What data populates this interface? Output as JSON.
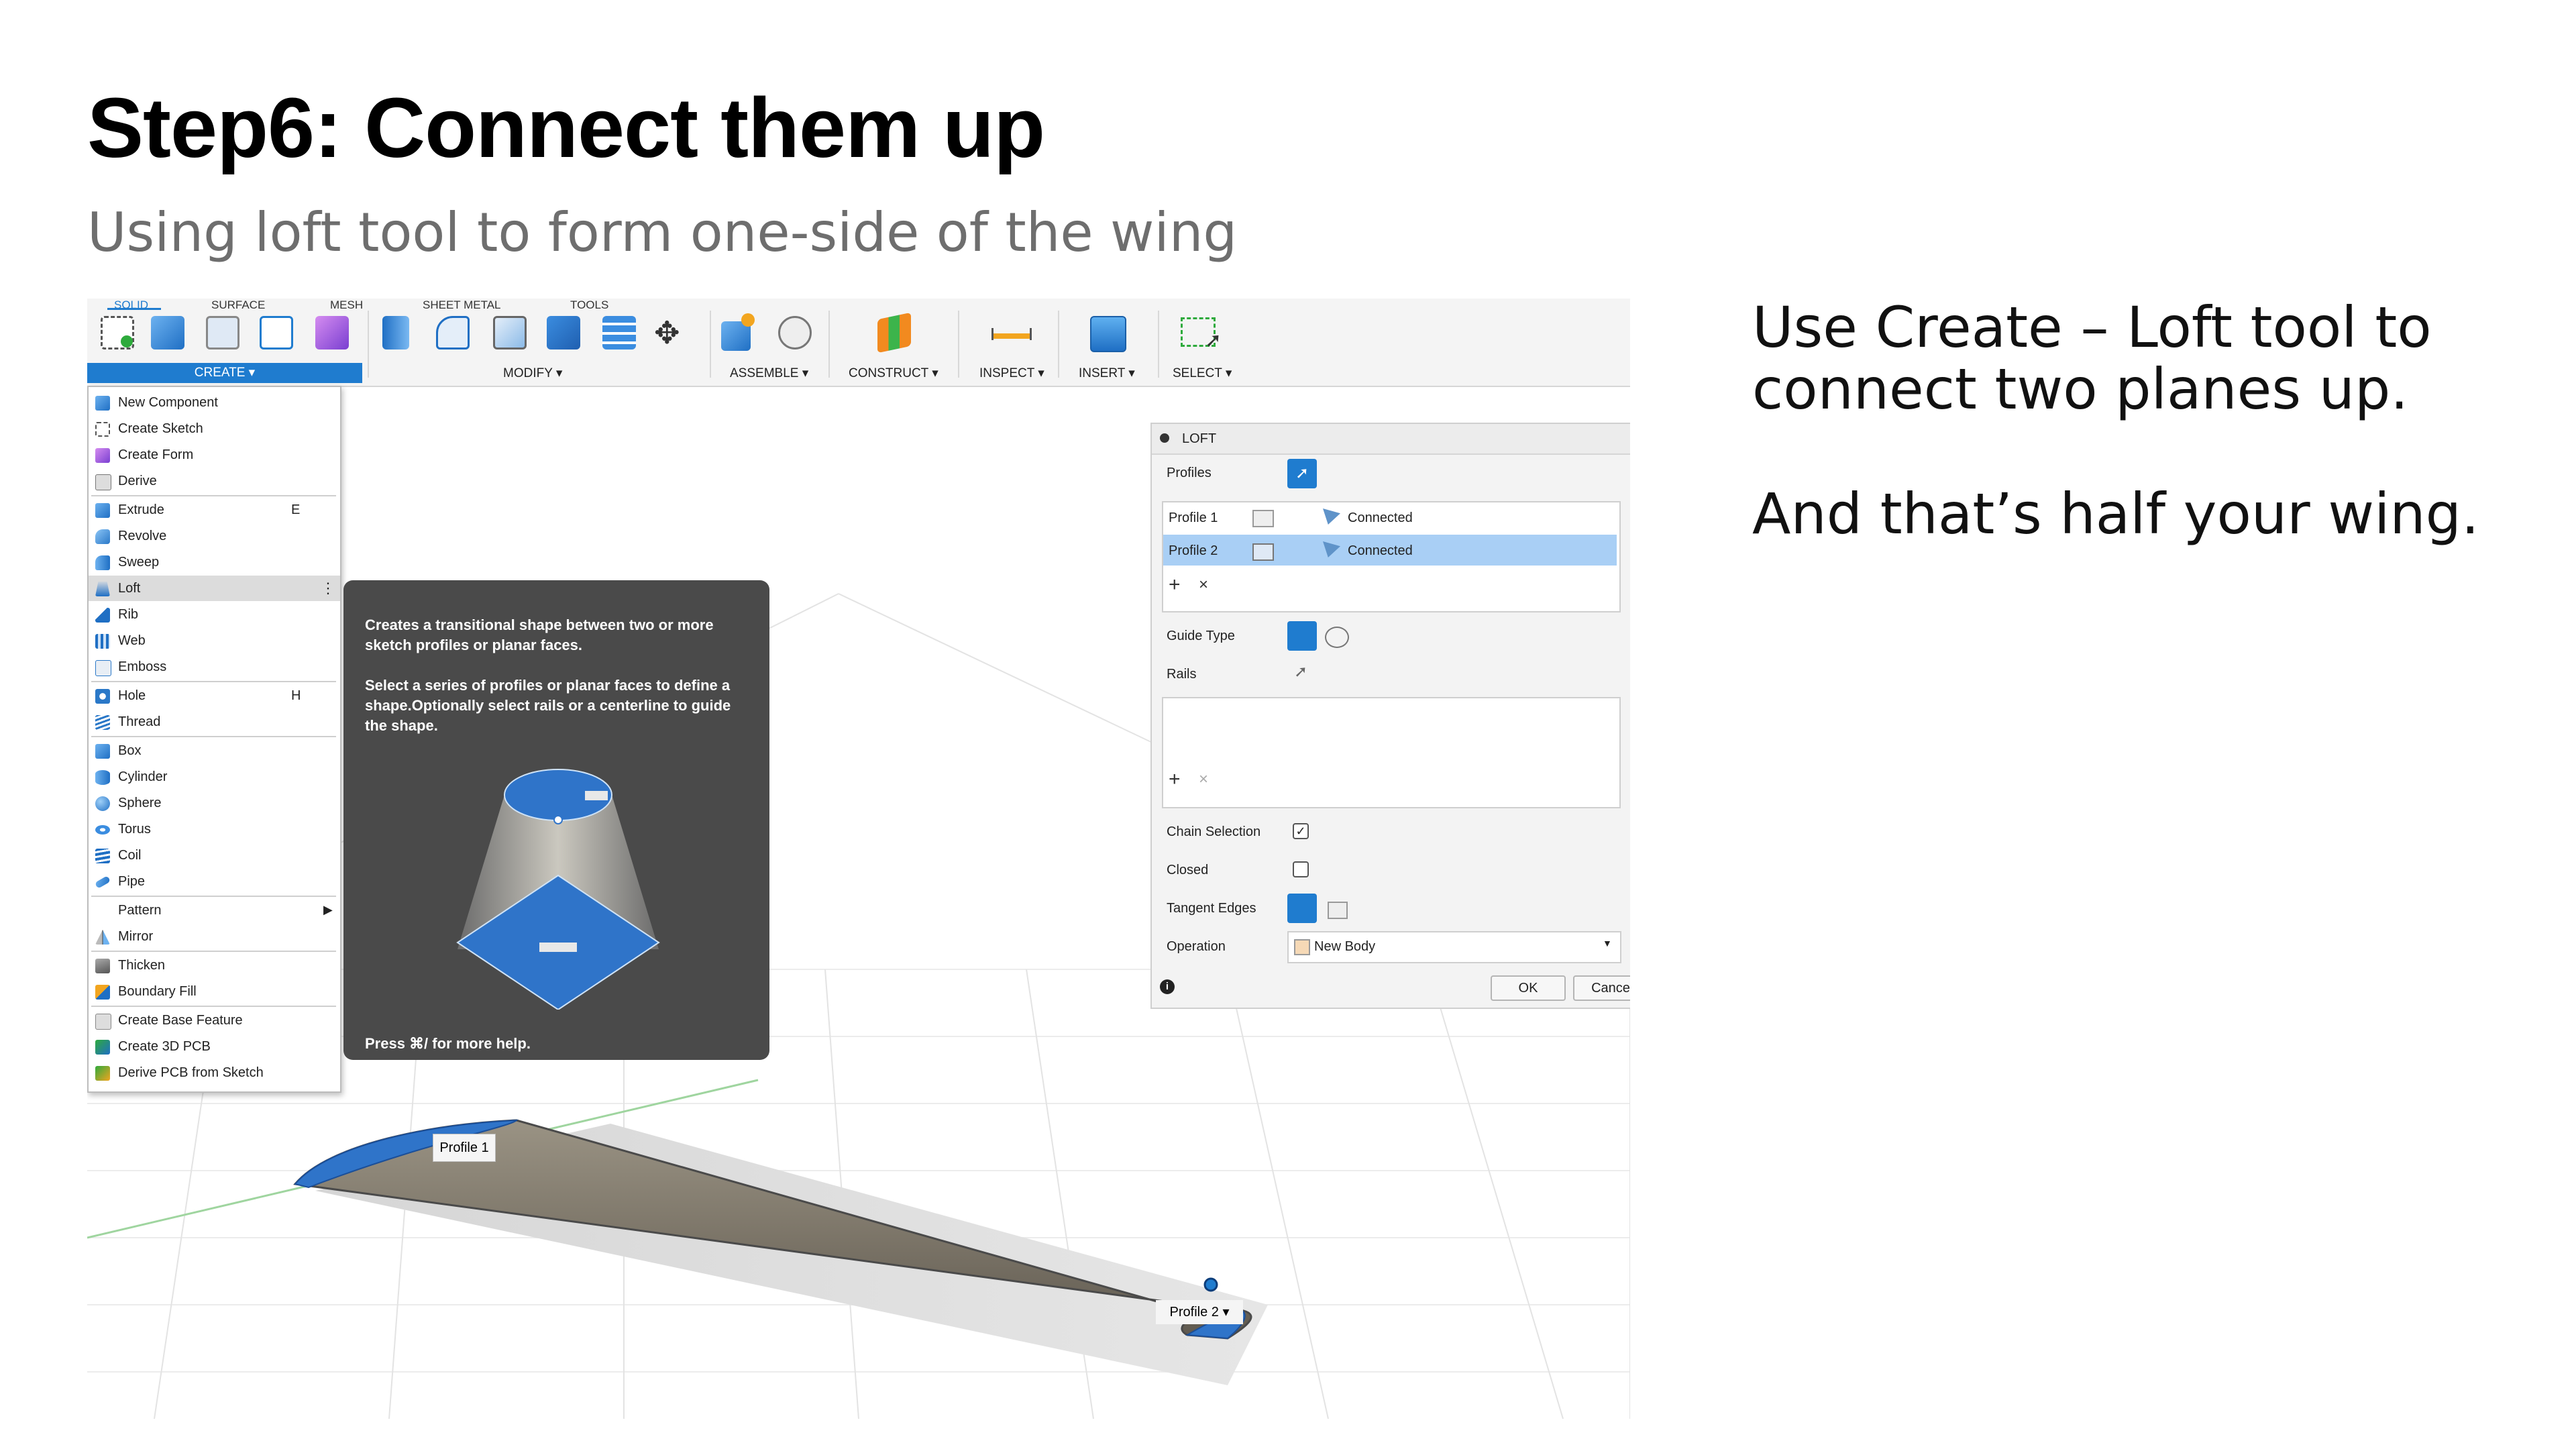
{
  "slide": {
    "title": "Step6: Connect them up",
    "subtitle": "Using loft tool to form one-side of the wing",
    "note_line1": "Use Create – Loft tool to",
    "note_line2": "connect two planes up.",
    "note_line3": "And that’s half your wing."
  },
  "ribbon": {
    "tabs": [
      "SOLID",
      "SURFACE",
      "MESH",
      "SHEET METAL",
      "TOOLS"
    ],
    "groups": {
      "create": "CREATE ▾",
      "modify": "MODIFY ▾",
      "assemble": "ASSEMBLE ▾",
      "construct": "CONSTRUCT ▾",
      "inspect": "INSPECT ▾",
      "insert": "INSERT ▾",
      "select": "SELECT ▾"
    }
  },
  "create_menu": {
    "items": [
      {
        "label": "New Component",
        "shortcut": ""
      },
      {
        "label": "Create Sketch",
        "shortcut": ""
      },
      {
        "label": "Create Form",
        "shortcut": ""
      },
      {
        "label": "Derive",
        "shortcut": ""
      },
      {
        "label": "Extrude",
        "shortcut": "E"
      },
      {
        "label": "Revolve",
        "shortcut": ""
      },
      {
        "label": "Sweep",
        "shortcut": ""
      },
      {
        "label": "Loft",
        "shortcut": ""
      },
      {
        "label": "Rib",
        "shortcut": ""
      },
      {
        "label": "Web",
        "shortcut": ""
      },
      {
        "label": "Emboss",
        "shortcut": ""
      },
      {
        "label": "Hole",
        "shortcut": "H"
      },
      {
        "label": "Thread",
        "shortcut": ""
      },
      {
        "label": "Box",
        "shortcut": ""
      },
      {
        "label": "Cylinder",
        "shortcut": ""
      },
      {
        "label": "Sphere",
        "shortcut": ""
      },
      {
        "label": "Torus",
        "shortcut": ""
      },
      {
        "label": "Coil",
        "shortcut": ""
      },
      {
        "label": "Pipe",
        "shortcut": ""
      },
      {
        "label": "Pattern",
        "shortcut": ""
      },
      {
        "label": "Mirror",
        "shortcut": ""
      },
      {
        "label": "Thicken",
        "shortcut": ""
      },
      {
        "label": "Boundary Fill",
        "shortcut": ""
      },
      {
        "label": "Create Base Feature",
        "shortcut": ""
      },
      {
        "label": "Create 3D PCB",
        "shortcut": ""
      },
      {
        "label": "Derive PCB from Sketch",
        "shortcut": ""
      }
    ]
  },
  "tooltip": {
    "para1": "Creates a transitional shape between two or more sketch profiles or planar faces.",
    "para2": "Select a series of profiles or planar faces to define a shape.Optionally select rails or a centerline to guide the shape.",
    "help": "Press ⌘/ for more help."
  },
  "loft": {
    "title": "LOFT",
    "profiles_label": "Profiles",
    "rows": [
      {
        "name": "Profile 1",
        "status": "Connected"
      },
      {
        "name": "Profile 2",
        "status": "Connected"
      }
    ],
    "guide_type_label": "Guide Type",
    "rails_label": "Rails",
    "chain_selection_label": "Chain Selection",
    "chain_selection_checked": true,
    "closed_label": "Closed",
    "closed_checked": false,
    "tangent_edges_label": "Tangent Edges",
    "operation_label": "Operation",
    "operation_value": "New Body",
    "ok_label": "OK",
    "cancel_label": "Cance"
  },
  "canvas": {
    "profile1_label": "Profile 1",
    "profile2_label": "Profile 2 ▾"
  },
  "colors": {
    "accent_blue": "#1f7ccf",
    "selected_row": "#a9cff5",
    "tooltip_bg": "#4a4a4a",
    "wing_surface": "#8b8476"
  }
}
